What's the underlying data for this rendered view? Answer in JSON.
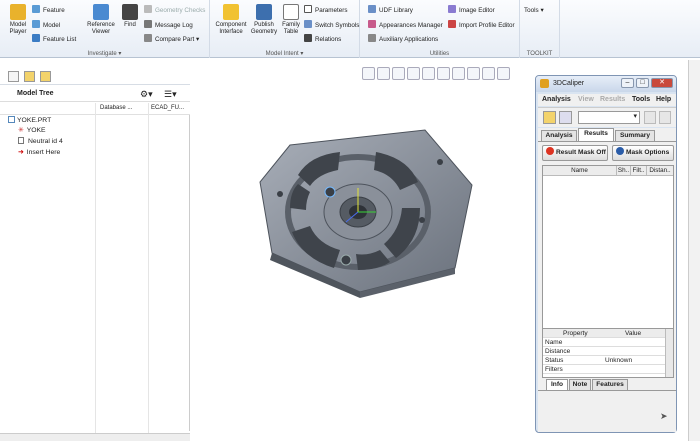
{
  "ribbon": {
    "model_player": "Model Player",
    "feature": "Feature",
    "model": "Model",
    "feature_list": "Feature List",
    "reference_viewer": "Reference Viewer",
    "find": "Find",
    "geometry_checks": "Geometry Checks",
    "message_log": "Message Log",
    "compare_part": "Compare Part",
    "investigate": "Investigate",
    "component_interface": "Component Interface",
    "publish_geometry": "Publish Geometry",
    "family_table": "Family Table",
    "parameters": "Parameters",
    "switch_symbols": "Switch Symbols",
    "relations": "Relations",
    "model_intent": "Model Intent",
    "udf_library": "UDF Library",
    "appearances_manager": "Appearances Manager",
    "auxiliary_applications": "Auxiliary Applications",
    "image_editor": "Image Editor",
    "import_profile_editor": "Import Profile Editor",
    "utilities": "Utilities",
    "tools": "Tools",
    "toolkit": "TOOLKIT"
  },
  "tree": {
    "title": "Model Tree",
    "col_database": "Database ...",
    "col_ecad": "ECAD_FU...",
    "items": [
      "YOKE.PRT",
      "YOKE",
      "Neutral id 4",
      "Insert Here"
    ]
  },
  "caliper": {
    "title": "3DCaliper",
    "menu": [
      "Analysis",
      "View",
      "Results",
      "Tools",
      "Help"
    ],
    "tabs": [
      "Analysis",
      "Results",
      "Summary"
    ],
    "active_tab": "Results",
    "result_mask_off": "Result Mask Off",
    "mask_options": "Mask Options",
    "columns": [
      "Name",
      "Sh..",
      "Filt..",
      "Distan.."
    ],
    "prop_header": [
      "Property",
      "Value"
    ],
    "props": [
      {
        "name": "Name",
        "value": ""
      },
      {
        "name": "Distance",
        "value": ""
      },
      {
        "name": "Status",
        "value": "Unknown"
      },
      {
        "name": "Filters",
        "value": ""
      }
    ],
    "bottom_tabs": [
      "Info",
      "Note",
      "Features"
    ]
  }
}
